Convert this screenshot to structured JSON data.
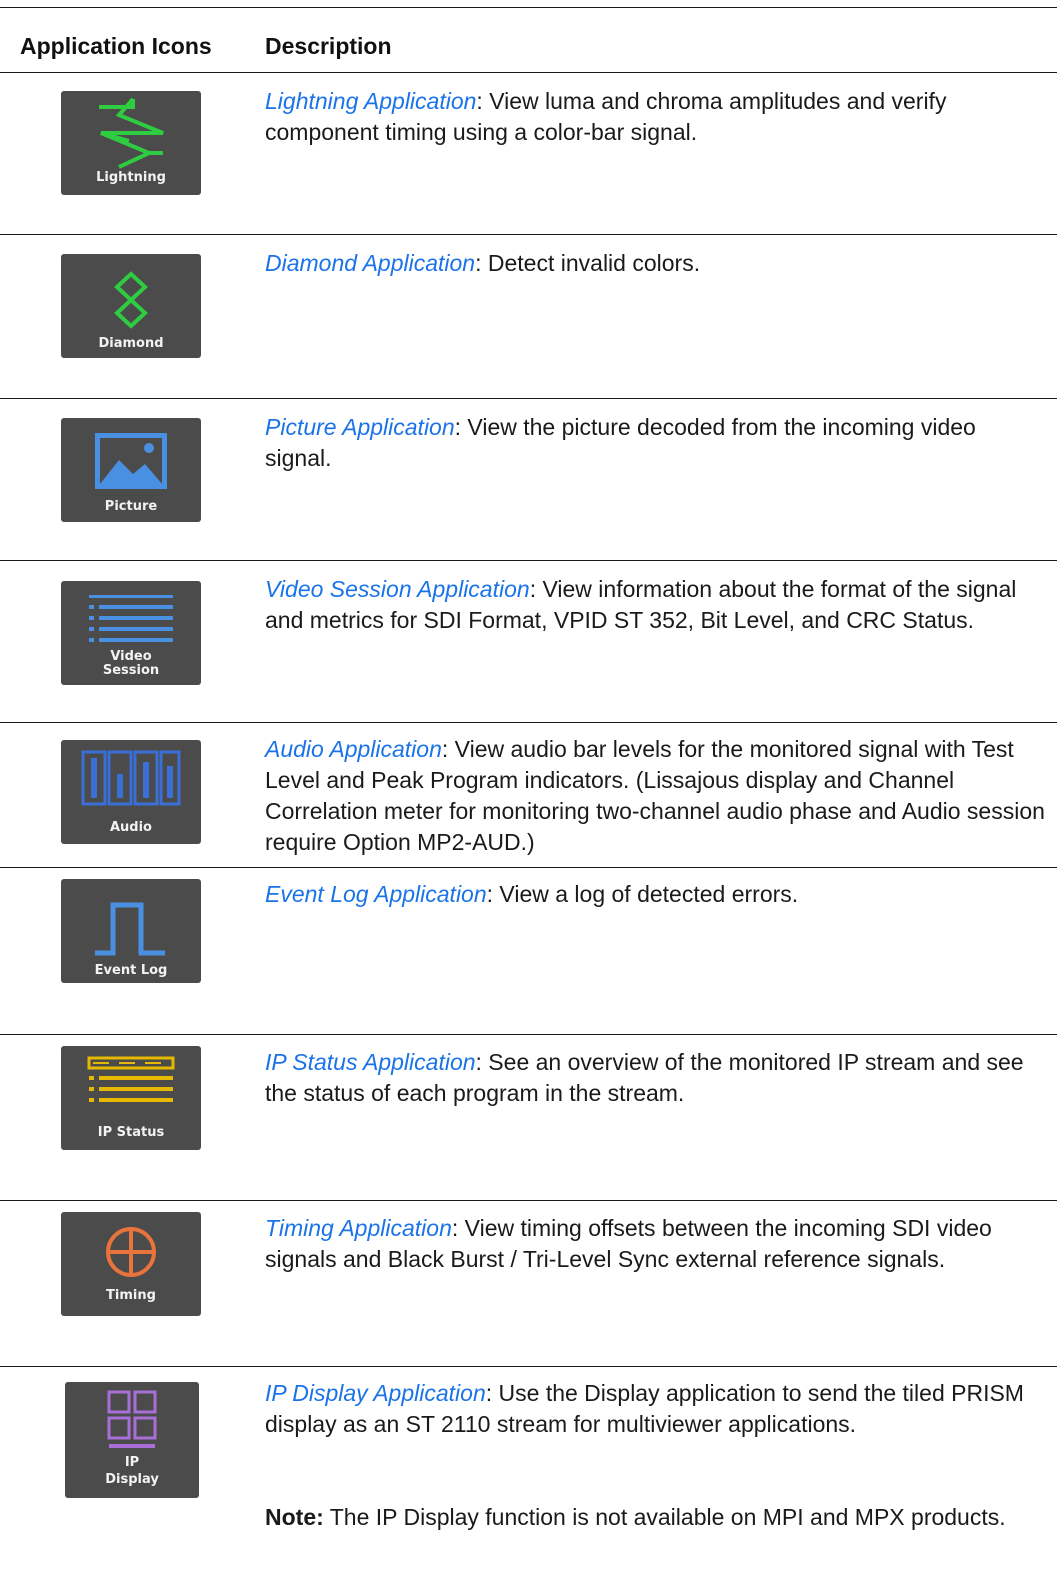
{
  "header": {
    "col_icons": "Application Icons",
    "col_description": "Description"
  },
  "rows": [
    {
      "icon_label": "Lightning",
      "icon": "lightning-icon",
      "link": "Lightning Application",
      "text": ": View luma and chroma amplitudes and verify component timing using a color-bar signal."
    },
    {
      "icon_label": "Diamond",
      "icon": "diamond-icon",
      "link": "Diamond Application",
      "text": ": Detect invalid colors."
    },
    {
      "icon_label": "Picture",
      "icon": "picture-icon",
      "link": "Picture Application",
      "text": ": View the picture decoded from the incoming video signal."
    },
    {
      "icon_label": "Video Session",
      "icon": "video-session-icon",
      "link": "Video Session Application",
      "text": ": View information about the format of the signal and metrics for SDI Format, VPID ST 352, Bit Level, and CRC Status."
    },
    {
      "icon_label": "Audio",
      "icon": "audio-icon",
      "link": "Audio Application",
      "text": ": View audio bar levels for the monitored signal with Test Level and Peak Program indicators. (Lissajous display and Channel Correlation meter for monitoring two-channel audio phase and Audio session require Option MP2-AUD.)"
    },
    {
      "icon_label": "Event Log",
      "icon": "event-log-icon",
      "link": "Event Log Application",
      "text": ": View a log of detected errors."
    },
    {
      "icon_label": "IP Status",
      "icon": "ip-status-icon",
      "link": "IP Status Application",
      "text": ": See an overview of the monitored IP stream and see the status of each program in the stream."
    },
    {
      "icon_label": "Timing",
      "icon": "timing-icon",
      "link": "Timing Application",
      "text": ": View timing offsets between the incoming SDI video signals and Black Burst / Tri-Level Sync external reference signals."
    },
    {
      "icon_label": "IP Display",
      "icon": "ip-display-icon",
      "link": "IP Display Application",
      "text": ": Use the Display application to send the tiled PRISM display as an ST 2110 stream for multiviewer applications."
    }
  ],
  "note": {
    "label": "Note:",
    "text": " The IP Display function is not available on MPI and MPX products."
  },
  "colors": {
    "link": "#1a73e8",
    "icon_bg": "#4b4b4b",
    "lightning": "#2ecc40",
    "picture": "#4a90e2",
    "audio": "#3a6fd8",
    "ip_status": "#e6b800",
    "timing": "#e8743b",
    "ip_display": "#a86fd6"
  }
}
